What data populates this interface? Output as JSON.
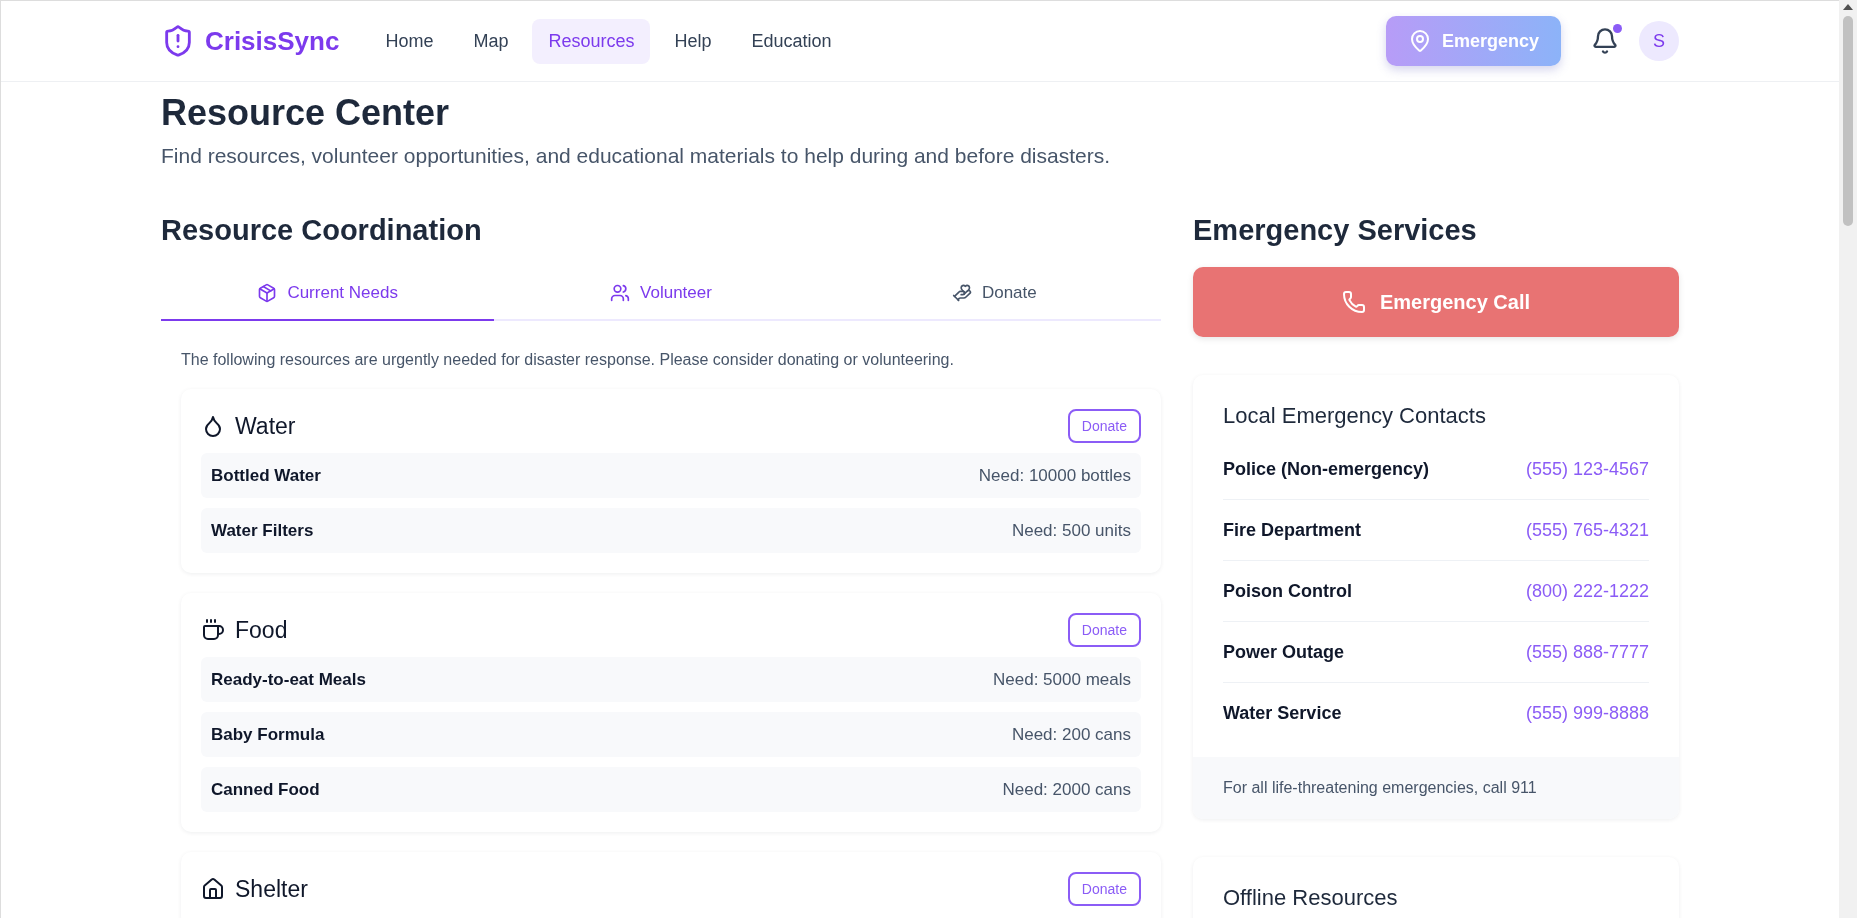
{
  "header": {
    "brand": "CrisisSync",
    "nav": [
      {
        "label": "Home",
        "selected": false
      },
      {
        "label": "Map",
        "selected": false
      },
      {
        "label": "Resources",
        "selected": true
      },
      {
        "label": "Help",
        "selected": false
      },
      {
        "label": "Education",
        "selected": false
      }
    ],
    "emergency_button": "Emergency",
    "notifications": {
      "unread": true
    },
    "avatar": "S"
  },
  "page": {
    "title": "Resource Center",
    "subtitle": "Find resources, volunteer opportunities, and educational materials to help during and before disasters."
  },
  "coordination": {
    "title": "Resource Coordination",
    "tabs": [
      {
        "label": "Current Needs",
        "selected": true,
        "hovered": false
      },
      {
        "label": "Volunteer",
        "selected": false,
        "hovered": true
      },
      {
        "label": "Donate",
        "selected": false,
        "hovered": false
      }
    ],
    "description": "The following resources are urgently needed for disaster response. Please consider donating or volunteering.",
    "categories": [
      {
        "kind": "water",
        "name": "Water",
        "button": "Donate",
        "items": [
          {
            "name": "Bottled Water",
            "need": "Need: 10000 bottles"
          },
          {
            "name": "Water Filters",
            "need": "Need: 500 units"
          }
        ]
      },
      {
        "kind": "food",
        "name": "Food",
        "button": "Donate",
        "items": [
          {
            "name": "Ready-to-eat Meals",
            "need": "Need: 5000 meals"
          },
          {
            "name": "Baby Formula",
            "need": "Need: 200 cans"
          },
          {
            "name": "Canned Food",
            "need": "Need: 2000 cans"
          }
        ]
      },
      {
        "kind": "shelter",
        "name": "Shelter",
        "button": "Donate"
      }
    ]
  },
  "emergency_services": {
    "title": "Emergency Services",
    "call_button": "Emergency Call",
    "contacts_title": "Local Emergency Contacts",
    "contacts": [
      {
        "name": "Police (Non-emergency)",
        "phone": "(555) 123-4567"
      },
      {
        "name": "Fire Department",
        "phone": "(555) 765-4321"
      },
      {
        "name": "Poison Control",
        "phone": "(800) 222-1222"
      },
      {
        "name": "Power Outage",
        "phone": "(555) 888-7777"
      },
      {
        "name": "Water Service",
        "phone": "(555) 999-8888"
      }
    ],
    "note": "For all life-threatening emergencies, call 911",
    "offline_title": "Offline Resources"
  }
}
